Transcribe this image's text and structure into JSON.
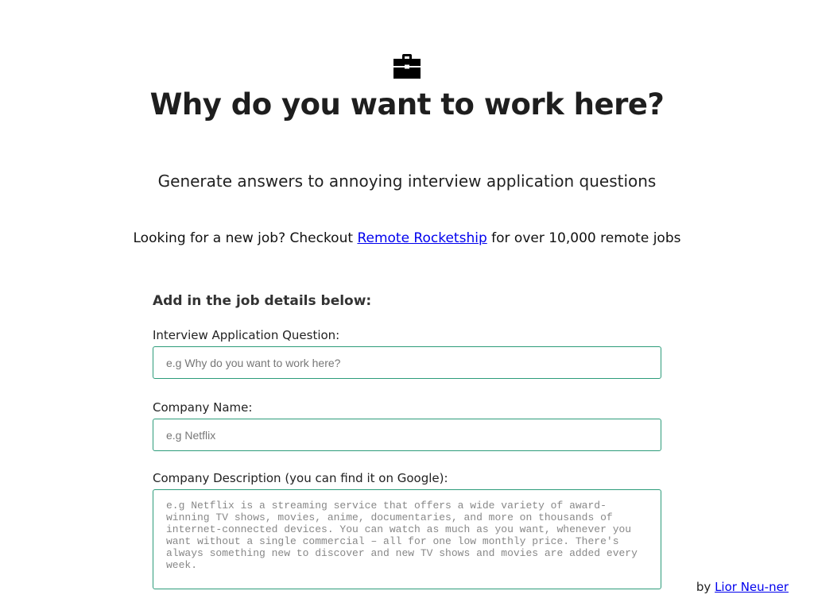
{
  "header": {
    "logo_icon": "briefcase-icon",
    "title": "Why do you want to work here?",
    "subtitle": "Generate answers to annoying interview application questions"
  },
  "promo": {
    "prefix": "Looking for a new job? Checkout ",
    "link_text": "Remote Rocketship",
    "suffix": " for over 10,000 remote jobs"
  },
  "form": {
    "heading": "Add in the job details below:",
    "question": {
      "label": "Interview Application Question:",
      "value": "",
      "placeholder": "e.g Why do you want to work here?"
    },
    "company_name": {
      "label": "Company Name:",
      "value": "",
      "placeholder": "e.g Netflix"
    },
    "company_description": {
      "label": "Company Description (you can find it on Google):",
      "value": "",
      "placeholder": "e.g Netflix is a streaming service that offers a wide variety of award-winning TV shows, movies, anime, documentaries, and more on thousands of internet-connected devices. You can watch as much as you want, whenever you want without a single commercial – all for one low monthly price. There's always something new to discover and new TV shows and movies are added every week."
    }
  },
  "credit": {
    "prefix": "by ",
    "link_text": "Lior Neu-ner"
  },
  "colors": {
    "input_border": "#2d9c7a",
    "link": "#0000ee",
    "title": "#1e1e1e"
  }
}
